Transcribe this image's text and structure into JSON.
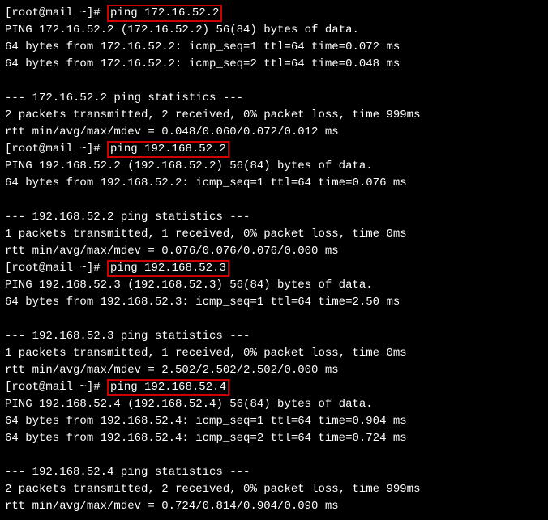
{
  "sessions": [
    {
      "prompt": "[root@mail ~]# ",
      "cmd": "ping 172.16.52.2",
      "header": "PING 172.16.52.2 (172.16.52.2) 56(84) bytes of data.",
      "replies": [
        "64 bytes from 172.16.52.2: icmp_seq=1 ttl=64 time=0.072 ms",
        "64 bytes from 172.16.52.2: icmp_seq=2 ttl=64 time=0.048 ms"
      ],
      "stats_header": "--- 172.16.52.2 ping statistics ---",
      "stats1": "2 packets transmitted, 2 received, 0% packet loss, time 999ms",
      "stats2": "rtt min/avg/max/mdev = 0.048/0.060/0.072/0.012 ms"
    },
    {
      "prompt": "[root@mail ~]# ",
      "cmd": "ping 192.168.52.2",
      "header": "PING 192.168.52.2 (192.168.52.2) 56(84) bytes of data.",
      "replies": [
        "64 bytes from 192.168.52.2: icmp_seq=1 ttl=64 time=0.076 ms"
      ],
      "stats_header": "--- 192.168.52.2 ping statistics ---",
      "stats1": "1 packets transmitted, 1 received, 0% packet loss, time 0ms",
      "stats2": "rtt min/avg/max/mdev = 0.076/0.076/0.076/0.000 ms"
    },
    {
      "prompt": "[root@mail ~]# ",
      "cmd": "ping 192.168.52.3",
      "header": "PING 192.168.52.3 (192.168.52.3) 56(84) bytes of data.",
      "replies": [
        "64 bytes from 192.168.52.3: icmp_seq=1 ttl=64 time=2.50 ms"
      ],
      "stats_header": "--- 192.168.52.3 ping statistics ---",
      "stats1": "1 packets transmitted, 1 received, 0% packet loss, time 0ms",
      "stats2": "rtt min/avg/max/mdev = 2.502/2.502/2.502/0.000 ms"
    },
    {
      "prompt": "[root@mail ~]# ",
      "cmd": "ping 192.168.52.4",
      "header": "PING 192.168.52.4 (192.168.52.4) 56(84) bytes of data.",
      "replies": [
        "64 bytes from 192.168.52.4: icmp_seq=1 ttl=64 time=0.904 ms",
        "64 bytes from 192.168.52.4: icmp_seq=2 ttl=64 time=0.724 ms"
      ],
      "stats_header": "--- 192.168.52.4 ping statistics ---",
      "stats1": "2 packets transmitted, 2 received, 0% packet loss, time 999ms",
      "stats2": "rtt min/avg/max/mdev = 0.724/0.814/0.904/0.090 ms"
    }
  ]
}
